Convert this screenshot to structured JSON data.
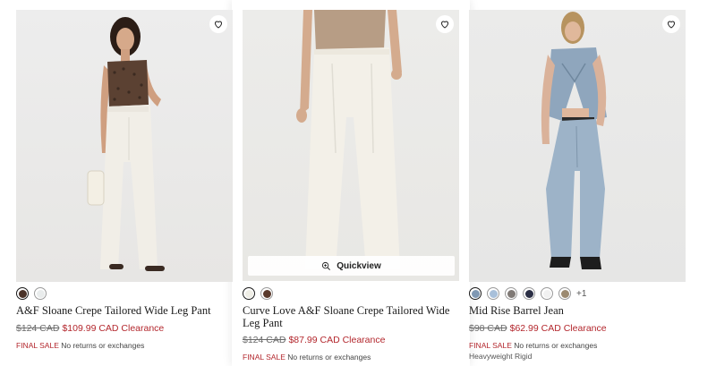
{
  "quickview_label": "Quickview",
  "products": [
    {
      "name": "A&F Sloane Crepe Tailored Wide Leg Pant",
      "old_price": "$124 CAD",
      "new_price": "$109.99 CAD Clearance",
      "final_sale": "FINAL SALE",
      "final_note": "No returns or exchanges",
      "swatches": [
        "#4a3228",
        "#e9ecec"
      ],
      "selected_swatch": 0
    },
    {
      "name": "Curve Love A&F Sloane Crepe Tailored Wide Leg Pant",
      "old_price": "$124 CAD",
      "new_price": "$87.99 CAD Clearance",
      "final_sale": "FINAL SALE",
      "final_note": "No returns or exchanges",
      "swatches": [
        "#efeee6",
        "#5a3a2c"
      ],
      "selected_swatch": 0
    },
    {
      "name": "Mid Rise Barrel Jean",
      "old_price": "$98 CAD",
      "new_price": "$62.99 CAD Clearance",
      "final_sale": "FINAL SALE",
      "final_note": "No returns or exchanges",
      "subtitle": "Heavyweight Rigid",
      "swatches": [
        "#7f98b3",
        "#a8c0da",
        "#807a76",
        "#2b2f45",
        "#f1f1f1",
        "#9c8a70"
      ],
      "more_colors": "+1",
      "selected_swatch": 0
    }
  ],
  "colors": {
    "sale_red": "#b3272d",
    "photo_bg": "#ececec"
  },
  "icons": {
    "favorite": "heart-outline-icon",
    "quickview": "zoom-in-icon"
  }
}
